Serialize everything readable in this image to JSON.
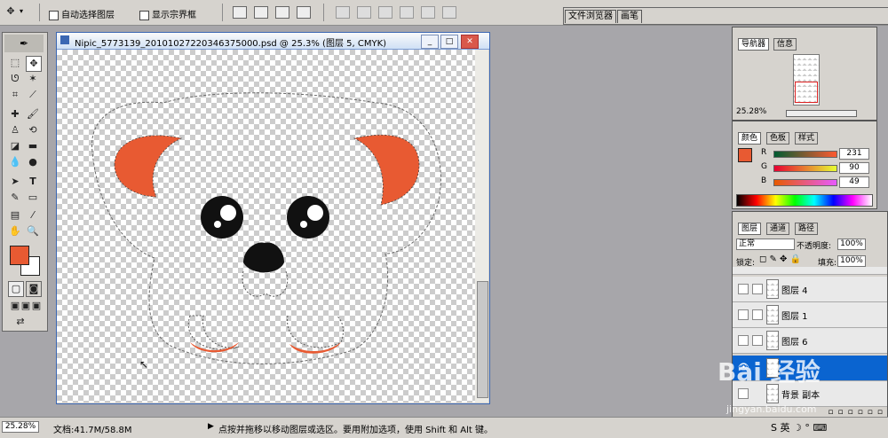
{
  "options_bar": {
    "auto_select_label": "自动选择图层",
    "show_bounds_label": "显示宗界框"
  },
  "palette_well": {
    "tabs": [
      "文件浏览器",
      "画笔"
    ]
  },
  "document": {
    "title": "Nipic_5773139_20101027220346375000.psd @ 25.3% (图层 5, CMYK)"
  },
  "navigator": {
    "tabs": [
      "导航器",
      "信息"
    ],
    "zoom": "25.28%"
  },
  "color_panel": {
    "tabs": [
      "颜色",
      "色板",
      "样式"
    ],
    "foreground_color": "#e85a32",
    "channels": [
      {
        "label": "R",
        "value": "231"
      },
      {
        "label": "G",
        "value": "90"
      },
      {
        "label": "B",
        "value": "49"
      }
    ]
  },
  "layers_panel": {
    "tabs": [
      "图层",
      "通道",
      "路径"
    ],
    "blend_mode": "正常",
    "opacity_label": "不透明度:",
    "opacity_value": "100%",
    "lock_label": "锁定:",
    "fill_label": "填充:",
    "fill_value": "100%",
    "layers": [
      {
        "name": "图层 4",
        "selected": false
      },
      {
        "name": "图层 1",
        "selected": false
      },
      {
        "name": "图层 6",
        "selected": false
      },
      {
        "name": "",
        "selected": true
      },
      {
        "name": "背景 副本",
        "selected": false
      }
    ]
  },
  "status_bar": {
    "zoom": "25.28%",
    "doc_info": "文档:41.7M/58.8M",
    "hint": "点按并拖移以移动图层或选区。要用附加选项，使用 Shift 和 Alt 键。"
  },
  "watermark": {
    "text": "Bai 经验",
    "url": "jingyan.baidu.com"
  },
  "colors": {
    "accent_orange": "#e85a32",
    "selection_blue": "#0a64d0"
  }
}
